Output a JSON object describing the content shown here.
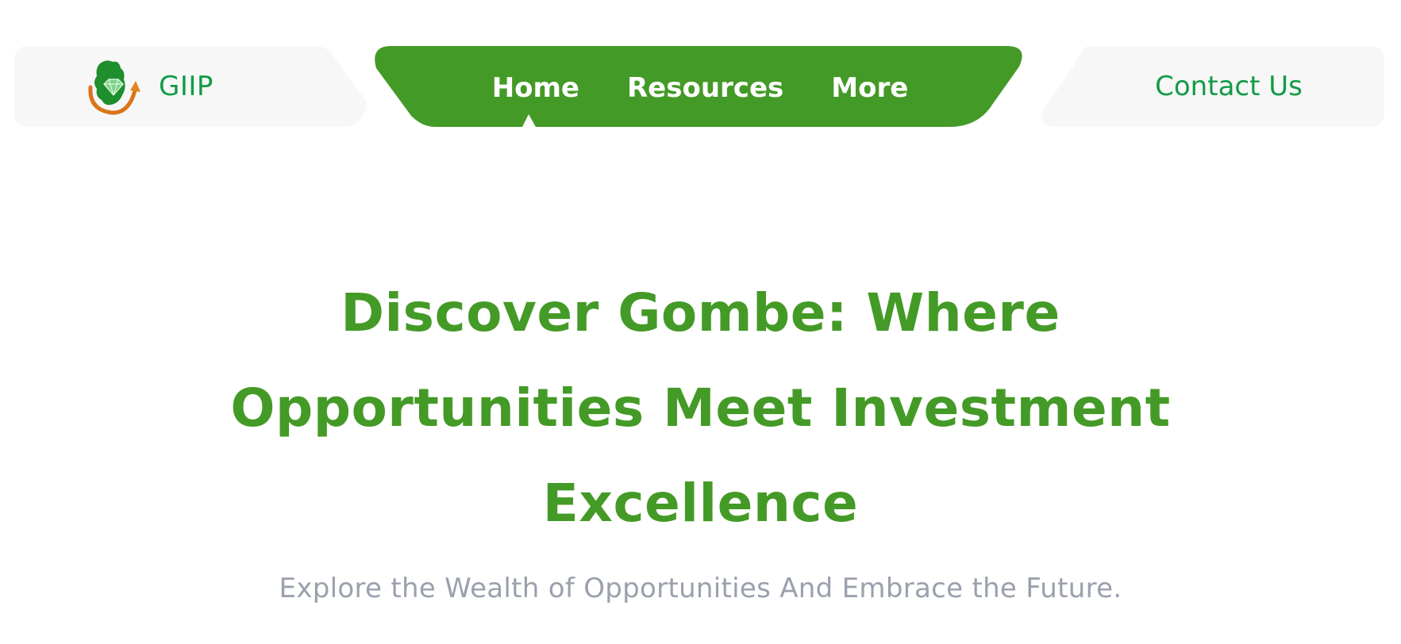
{
  "colors": {
    "brand_green": "#449a26",
    "logo_text_green": "#129b47",
    "panel_gray": "#f7f7f7",
    "subtitle_gray": "#9aa0ad"
  },
  "header": {
    "brand_name": "GIIP",
    "logo_icon": "gombe-map-diamond-logo",
    "nav": [
      {
        "label": "Home",
        "active": true
      },
      {
        "label": "Resources"
      },
      {
        "label": "More"
      }
    ],
    "contact_label": "Contact Us"
  },
  "hero": {
    "title": "Discover Gombe: Where Opportunities Meet Investment Excellence",
    "subtitle": "Explore the Wealth of Opportunities And Embrace the Future."
  }
}
